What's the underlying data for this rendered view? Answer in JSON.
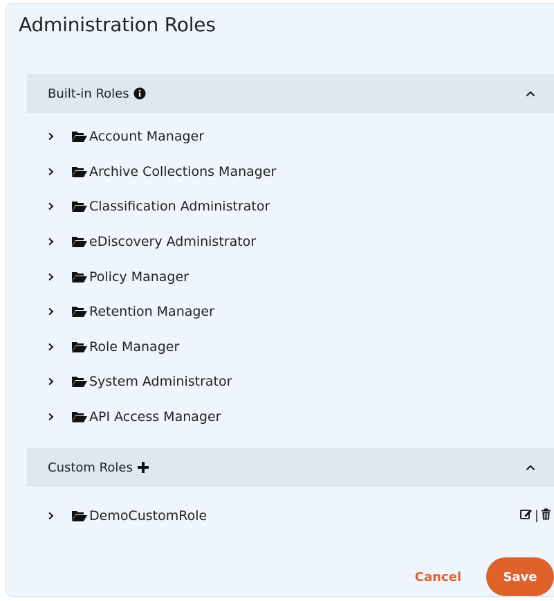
{
  "dialog": {
    "title": "Administration Roles"
  },
  "builtin": {
    "label": "Built-in Roles",
    "info_icon": "info-circle-icon",
    "collapse_icon": "chevron-up-icon",
    "items": [
      {
        "label": "Account Manager"
      },
      {
        "label": "Archive Collections Manager"
      },
      {
        "label": "Classification Administrator"
      },
      {
        "label": "eDiscovery Administrator"
      },
      {
        "label": "Policy Manager"
      },
      {
        "label": "Retention Manager"
      },
      {
        "label": "Role Manager"
      },
      {
        "label": "System Administrator"
      },
      {
        "label": "API Access Manager"
      }
    ]
  },
  "custom": {
    "label": "Custom Roles",
    "add_icon": "plus-icon",
    "collapse_icon": "chevron-up-icon",
    "items": [
      {
        "label": "DemoCustomRole",
        "actions_separator": "|",
        "edit_icon": "edit-icon",
        "delete_icon": "trash-icon"
      }
    ]
  },
  "footer": {
    "cancel_label": "Cancel",
    "save_label": "Save"
  },
  "colors": {
    "accent": "#e0622b",
    "panel_background": "#eef5fc",
    "section_header_background": "#dde8f1"
  }
}
